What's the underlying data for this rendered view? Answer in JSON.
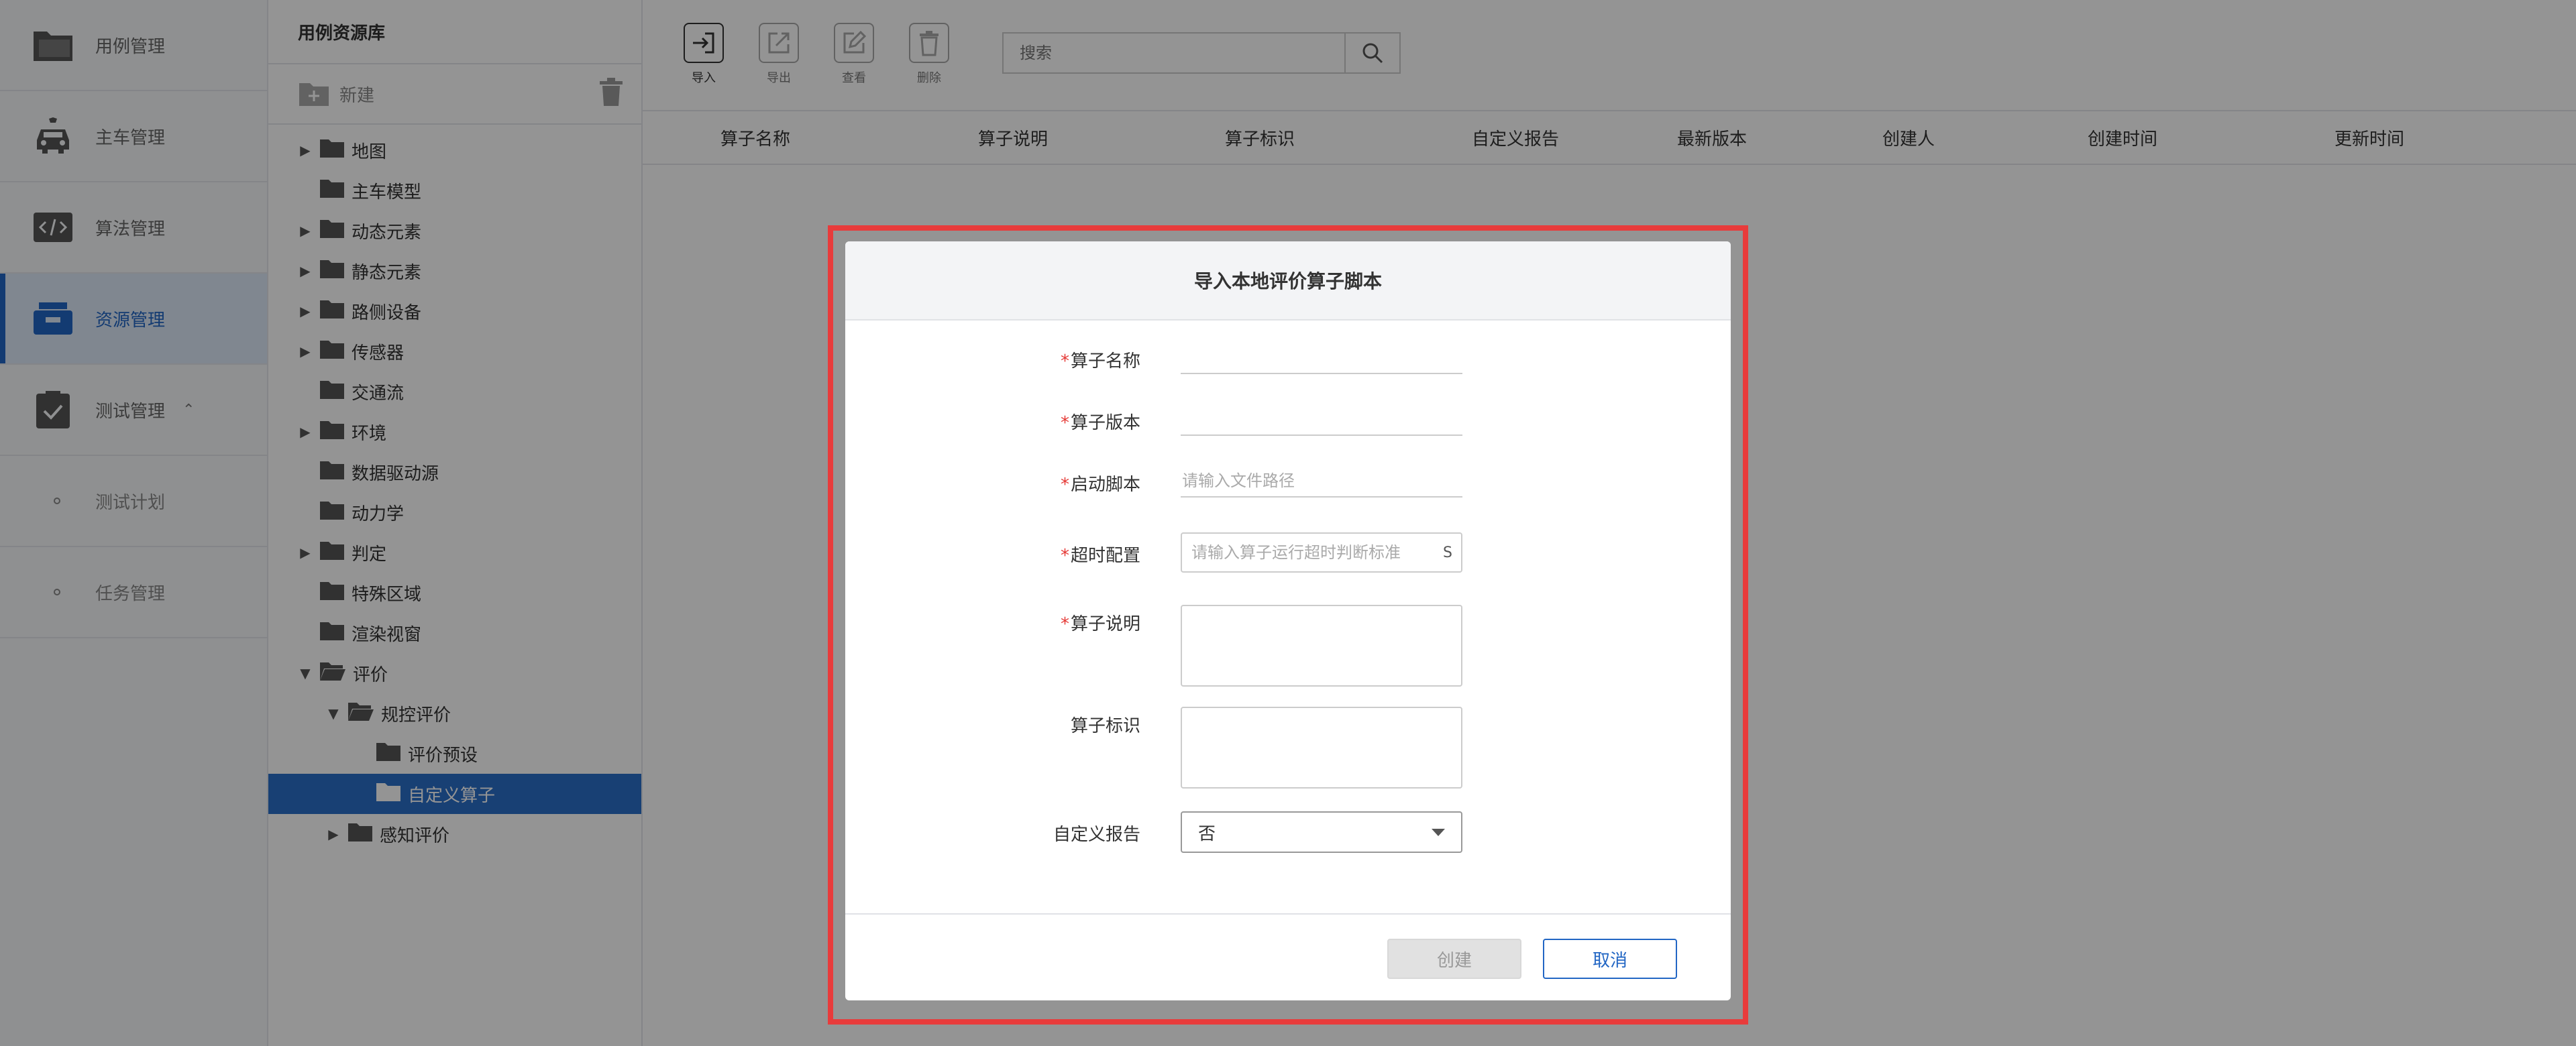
{
  "nav": {
    "items": [
      {
        "label": "用例管理",
        "icon": "folder-icon"
      },
      {
        "label": "主车管理",
        "icon": "car-icon"
      },
      {
        "label": "算法管理",
        "icon": "code-icon"
      },
      {
        "label": "资源管理",
        "icon": "resource-box-icon",
        "active": true
      },
      {
        "label": "测试管理",
        "icon": "clipboard-check-icon",
        "expanded": true
      }
    ],
    "sub_items": [
      {
        "label": "测试计划"
      },
      {
        "label": "任务管理"
      }
    ]
  },
  "tree": {
    "title": "用例资源库",
    "new_label": "新建",
    "nodes": [
      {
        "label": "地图",
        "level": 0,
        "arrow": "right"
      },
      {
        "label": "主车模型",
        "level": 0,
        "arrow": "none"
      },
      {
        "label": "动态元素",
        "level": 0,
        "arrow": "right"
      },
      {
        "label": "静态元素",
        "level": 0,
        "arrow": "right"
      },
      {
        "label": "路侧设备",
        "level": 0,
        "arrow": "right"
      },
      {
        "label": "传感器",
        "level": 0,
        "arrow": "right"
      },
      {
        "label": "交通流",
        "level": 0,
        "arrow": "none"
      },
      {
        "label": "环境",
        "level": 0,
        "arrow": "right"
      },
      {
        "label": "数据驱动源",
        "level": 0,
        "arrow": "none"
      },
      {
        "label": "动力学",
        "level": 0,
        "arrow": "none"
      },
      {
        "label": "判定",
        "level": 0,
        "arrow": "right"
      },
      {
        "label": "特殊区域",
        "level": 0,
        "arrow": "none"
      },
      {
        "label": "渲染视窗",
        "level": 0,
        "arrow": "none"
      },
      {
        "label": "评价",
        "level": 0,
        "arrow": "down",
        "open": true
      },
      {
        "label": "规控评价",
        "level": 1,
        "arrow": "down",
        "open": true
      },
      {
        "label": "评价预设",
        "level": 2,
        "arrow": "none"
      },
      {
        "label": "自定义算子",
        "level": 2,
        "arrow": "none",
        "selected": true
      },
      {
        "label": "感知评价",
        "level": 1,
        "arrow": "right"
      }
    ]
  },
  "toolbar": {
    "buttons": [
      {
        "label": "导入",
        "icon": "import-icon"
      },
      {
        "label": "导出",
        "icon": "export-icon"
      },
      {
        "label": "查看",
        "icon": "view-edit-icon"
      },
      {
        "label": "删除",
        "icon": "trash-icon"
      }
    ],
    "search_placeholder": "搜索"
  },
  "table": {
    "columns": [
      "算子名称",
      "算子说明",
      "算子标识",
      "自定义报告",
      "最新版本",
      "创建人",
      "创建时间",
      "更新时间"
    ]
  },
  "dialog": {
    "title": "导入本地评价算子脚本",
    "fields": {
      "name": {
        "label": "算子名称",
        "required": true,
        "value": ""
      },
      "version": {
        "label": "算子版本",
        "required": true,
        "value": ""
      },
      "script": {
        "label": "启动脚本",
        "required": true,
        "placeholder": "请输入文件路径"
      },
      "timeout": {
        "label": "超时配置",
        "required": true,
        "placeholder": "请输入算子运行超时判断标准",
        "unit": "S"
      },
      "desc": {
        "label": "算子说明",
        "required": true
      },
      "ident": {
        "label": "算子标识",
        "required": false
      },
      "report": {
        "label": "自定义报告",
        "required": false,
        "value": "否"
      }
    },
    "create_label": "创建",
    "cancel_label": "取消"
  },
  "colors": {
    "accent": "#2266c4",
    "selected_bg": "#2a6fc9",
    "required": "#e53935",
    "highlight": "#e83b3b"
  }
}
